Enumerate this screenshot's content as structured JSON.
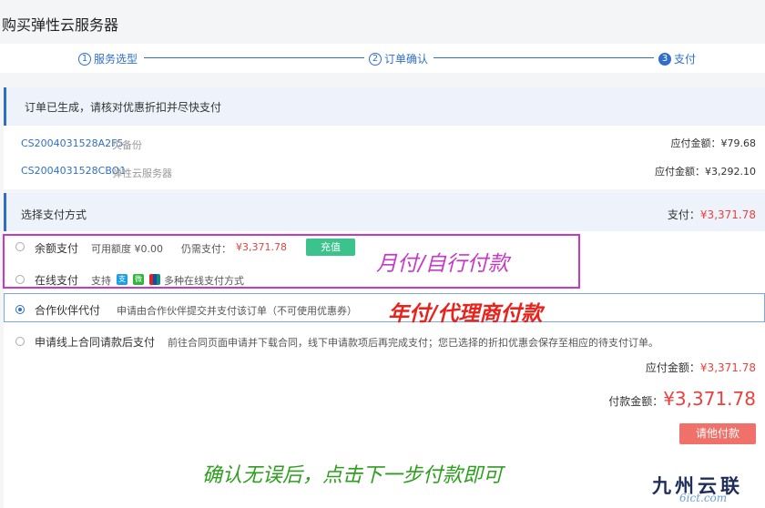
{
  "header": {
    "title": "购买弹性云服务器"
  },
  "steps": [
    {
      "num": "1",
      "label": "服务选型"
    },
    {
      "num": "2",
      "label": "订单确认"
    },
    {
      "num": "3",
      "label": "支付"
    }
  ],
  "notice": {
    "text": "订单已生成，请核对优惠折扣并尽快支付"
  },
  "orders": [
    {
      "order_no": "CS2004031528A2F5",
      "name": "灾备份",
      "amount_label": "应付金额：¥79.68"
    },
    {
      "order_no": "CS2004031528CBO1",
      "name": "弹性云服务器",
      "amount_label": "应付金额：¥3,292.10"
    }
  ],
  "payment": {
    "section_title": "选择支付方式",
    "total_label": "支付：",
    "total_value": "¥3,371.78",
    "balance": {
      "label": "余额支付",
      "available_label": "可用额度 ¥0.00",
      "need_label": "仍需支付：",
      "need_value": "¥3,371.78",
      "recharge_button": "充值"
    },
    "online": {
      "label": "在线支付",
      "support_label": "支持",
      "more_label": "多种在线支付方式"
    },
    "partner": {
      "label": "合作伙伴代付",
      "desc": "申请由合作伙伴提交并支付该订单（不可使用优惠券）"
    },
    "contract": {
      "label": "申请线上合同请款后支付",
      "desc": "前往合同页面申请并下载合同，线下申请款项后再完成支付；您已选择的折扣优惠会保存至相应的待支付订单。"
    },
    "payable_label": "应付金额：",
    "payable_value": "¥3,371.78",
    "pay_amount_label": "付款金额：",
    "pay_amount_value": "¥3,371.78",
    "pay_button": "请他付款"
  },
  "annotations": {
    "monthly": "月付/自行付款",
    "yearly": "年付/代理商付款",
    "confirm": "确认无误后，点击下一步付款即可"
  },
  "watermark": {
    "cn": "九州云联",
    "en": "6ict.com"
  },
  "colors": {
    "accent_blue": "#2f6fc9",
    "price_red": "#e8423f",
    "recharge_green": "#3cc28c",
    "pay_button": "#f0706a",
    "annotation_purple": "#c738c7",
    "annotation_red": "#e8231c",
    "annotation_green": "#2e9e1e"
  },
  "icons": {
    "alipay": "alipay-icon",
    "wechat": "wechat-pay-icon",
    "unionpay": "unionpay-icon"
  }
}
